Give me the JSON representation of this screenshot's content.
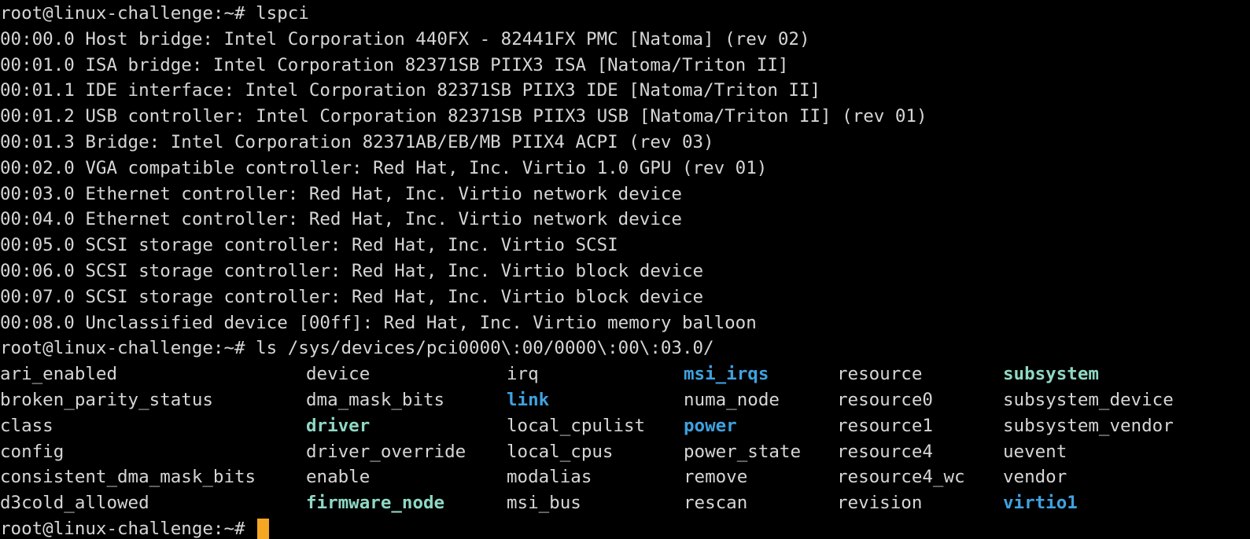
{
  "terminal": {
    "prompt": "root@linux-challenge:~# ",
    "command1": "lspci",
    "lspci_output": [
      "00:00.0 Host bridge: Intel Corporation 440FX - 82441FX PMC [Natoma] (rev 02)",
      "00:01.0 ISA bridge: Intel Corporation 82371SB PIIX3 ISA [Natoma/Triton II]",
      "00:01.1 IDE interface: Intel Corporation 82371SB PIIX3 IDE [Natoma/Triton II]",
      "00:01.2 USB controller: Intel Corporation 82371SB PIIX3 USB [Natoma/Triton II] (rev 01)",
      "00:01.3 Bridge: Intel Corporation 82371AB/EB/MB PIIX4 ACPI (rev 03)",
      "00:02.0 VGA compatible controller: Red Hat, Inc. Virtio 1.0 GPU (rev 01)",
      "00:03.0 Ethernet controller: Red Hat, Inc. Virtio network device",
      "00:04.0 Ethernet controller: Red Hat, Inc. Virtio network device",
      "00:05.0 SCSI storage controller: Red Hat, Inc. Virtio SCSI",
      "00:06.0 SCSI storage controller: Red Hat, Inc. Virtio block device",
      "00:07.0 SCSI storage controller: Red Hat, Inc. Virtio block device",
      "00:08.0 Unclassified device [00ff]: Red Hat, Inc. Virtio memory balloon"
    ],
    "command2": "ls /sys/devices/pci0000\\:00/0000\\:00\\:03.0/",
    "ls_output": [
      [
        {
          "text": "ari_enabled",
          "style": "plain"
        },
        {
          "text": "device",
          "style": "plain"
        },
        {
          "text": "irq",
          "style": "plain"
        },
        {
          "text": "msi_irqs",
          "style": "blue"
        },
        {
          "text": "resource",
          "style": "plain"
        },
        {
          "text": "subsystem",
          "style": "teal"
        }
      ],
      [
        {
          "text": "broken_parity_status",
          "style": "plain"
        },
        {
          "text": "dma_mask_bits",
          "style": "plain"
        },
        {
          "text": "link",
          "style": "blue"
        },
        {
          "text": "numa_node",
          "style": "plain"
        },
        {
          "text": "resource0",
          "style": "plain"
        },
        {
          "text": "subsystem_device",
          "style": "plain"
        }
      ],
      [
        {
          "text": "class",
          "style": "plain"
        },
        {
          "text": "driver",
          "style": "teal"
        },
        {
          "text": "local_cpulist",
          "style": "plain"
        },
        {
          "text": "power",
          "style": "blue"
        },
        {
          "text": "resource1",
          "style": "plain"
        },
        {
          "text": "subsystem_vendor",
          "style": "plain"
        }
      ],
      [
        {
          "text": "config",
          "style": "plain"
        },
        {
          "text": "driver_override",
          "style": "plain"
        },
        {
          "text": "local_cpus",
          "style": "plain"
        },
        {
          "text": "power_state",
          "style": "plain"
        },
        {
          "text": "resource4",
          "style": "plain"
        },
        {
          "text": "uevent",
          "style": "plain"
        }
      ],
      [
        {
          "text": "consistent_dma_mask_bits",
          "style": "plain"
        },
        {
          "text": "enable",
          "style": "plain"
        },
        {
          "text": "modalias",
          "style": "plain"
        },
        {
          "text": "remove",
          "style": "plain"
        },
        {
          "text": "resource4_wc",
          "style": "plain"
        },
        {
          "text": "vendor",
          "style": "plain"
        }
      ],
      [
        {
          "text": "d3cold_allowed",
          "style": "plain"
        },
        {
          "text": "firmware_node",
          "style": "teal"
        },
        {
          "text": "msi_bus",
          "style": "plain"
        },
        {
          "text": "rescan",
          "style": "plain"
        },
        {
          "text": "revision",
          "style": "plain"
        },
        {
          "text": "virtio1",
          "style": "blue"
        }
      ]
    ],
    "colors": {
      "background": "#000000",
      "foreground": "#d6d6d6",
      "symlink_teal": "#8fd8c4",
      "directory_blue": "#3fa2e0",
      "cursor": "#f5a623"
    }
  }
}
